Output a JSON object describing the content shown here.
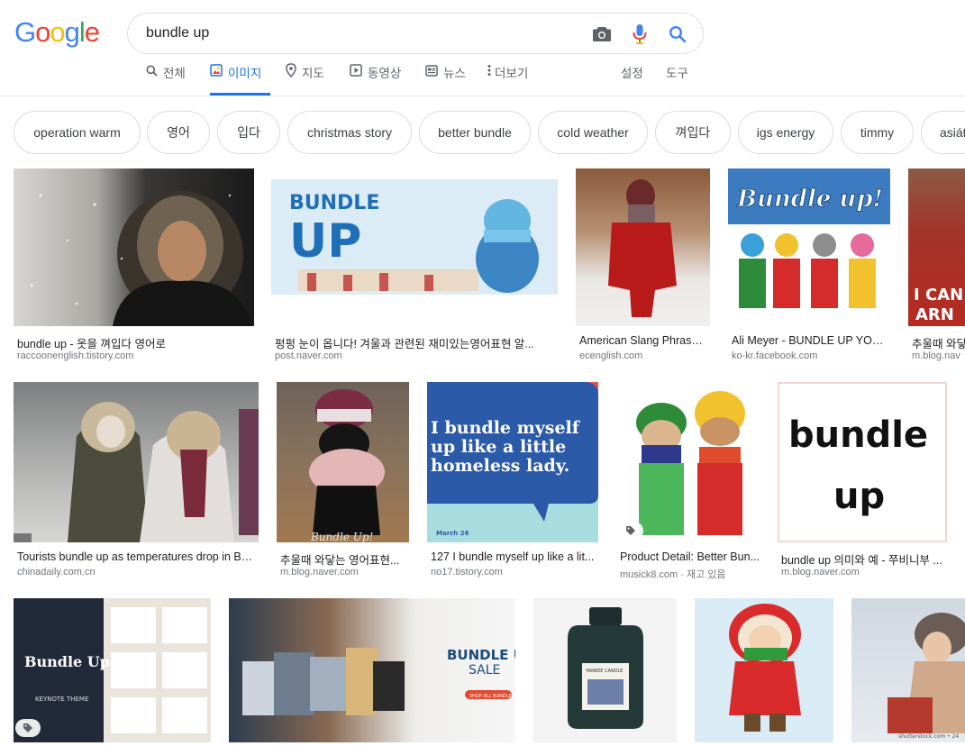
{
  "logo": {
    "letters": [
      "G",
      "o",
      "o",
      "g",
      "l",
      "e"
    ],
    "colors": [
      "#4285F4",
      "#EA4335",
      "#FBBC05",
      "#4285F4",
      "#34A853",
      "#EA4335"
    ]
  },
  "search": {
    "query": "bundle up",
    "camera_icon": "camera-icon",
    "mic_icon": "mic-icon",
    "search_icon": "search-icon"
  },
  "tabs": [
    {
      "label": "전체",
      "icon": "search-icon"
    },
    {
      "label": "이미지",
      "icon": "image-icon",
      "active": true
    },
    {
      "label": "지도",
      "icon": "map-pin-icon"
    },
    {
      "label": "동영상",
      "icon": "play-icon"
    },
    {
      "label": "뉴스",
      "icon": "news-icon"
    },
    {
      "label": "더보기",
      "icon": "more-vert-icon"
    }
  ],
  "settings_label": "설정",
  "tools_label": "도구",
  "chips": [
    "operation warm",
    "영어",
    "입다",
    "christmas story",
    "better bundle",
    "cold weather",
    "껴입다",
    "igs energy",
    "timmy",
    "asiát"
  ],
  "results": [
    {
      "caption": "bundle up - 옷을 껴입다 영어로",
      "source": "raccoonenglish.tistory.com"
    },
    {
      "caption": "펑펑 눈이 옵니다! 겨울과 관련된 재미있는영어표현 알...",
      "source": "post.naver.com",
      "art_text": [
        "BUNDLE",
        "UP"
      ]
    },
    {
      "caption": "American Slang Phrase:...",
      "source": "ecenglish.com"
    },
    {
      "caption": "Ali Meyer - BUNDLE UP YOUR ...",
      "source": "ko-kr.facebook.com",
      "art_text": [
        "Bundle up!"
      ]
    },
    {
      "caption": "추울때 와닿",
      "source": "m.blog.nav",
      "art_text": [
        "I CAN",
        "ARN"
      ]
    },
    {
      "caption": "Tourists bundle up as temperatures drop in Be...",
      "source": "chinadaily.com.cn"
    },
    {
      "caption": "추울때 와닿는 영어표현...",
      "source": "m.blog.naver.com",
      "art_text": [
        "Bundle Up!"
      ]
    },
    {
      "caption": "127 I bundle myself up like a lit...",
      "source": "no17.tistory.com",
      "art_text": [
        "I bundle myself",
        "up like a little",
        "homeless lady.",
        "March 26"
      ]
    },
    {
      "caption": "Product Detail: Better Bun...",
      "source": "musick8.com",
      "extra": " · 재고 있음"
    },
    {
      "caption": "bundle up 의미와 예 - 쭈비니부 ...",
      "source": "m.blog.naver.com",
      "art_text": [
        "bundle",
        "up"
      ]
    },
    {
      "art_text": [
        "Bundle Up",
        "KEYNOTE THEME"
      ]
    },
    {
      "art_text": [
        "BUNDLE UP",
        "SALE",
        "SHOP ALL BUNDLES"
      ]
    },
    {
      "art_text": [
        "YANKEE CANDLE"
      ]
    },
    {},
    {
      "art_text": [
        "shutterstock.com • 24"
      ]
    }
  ]
}
